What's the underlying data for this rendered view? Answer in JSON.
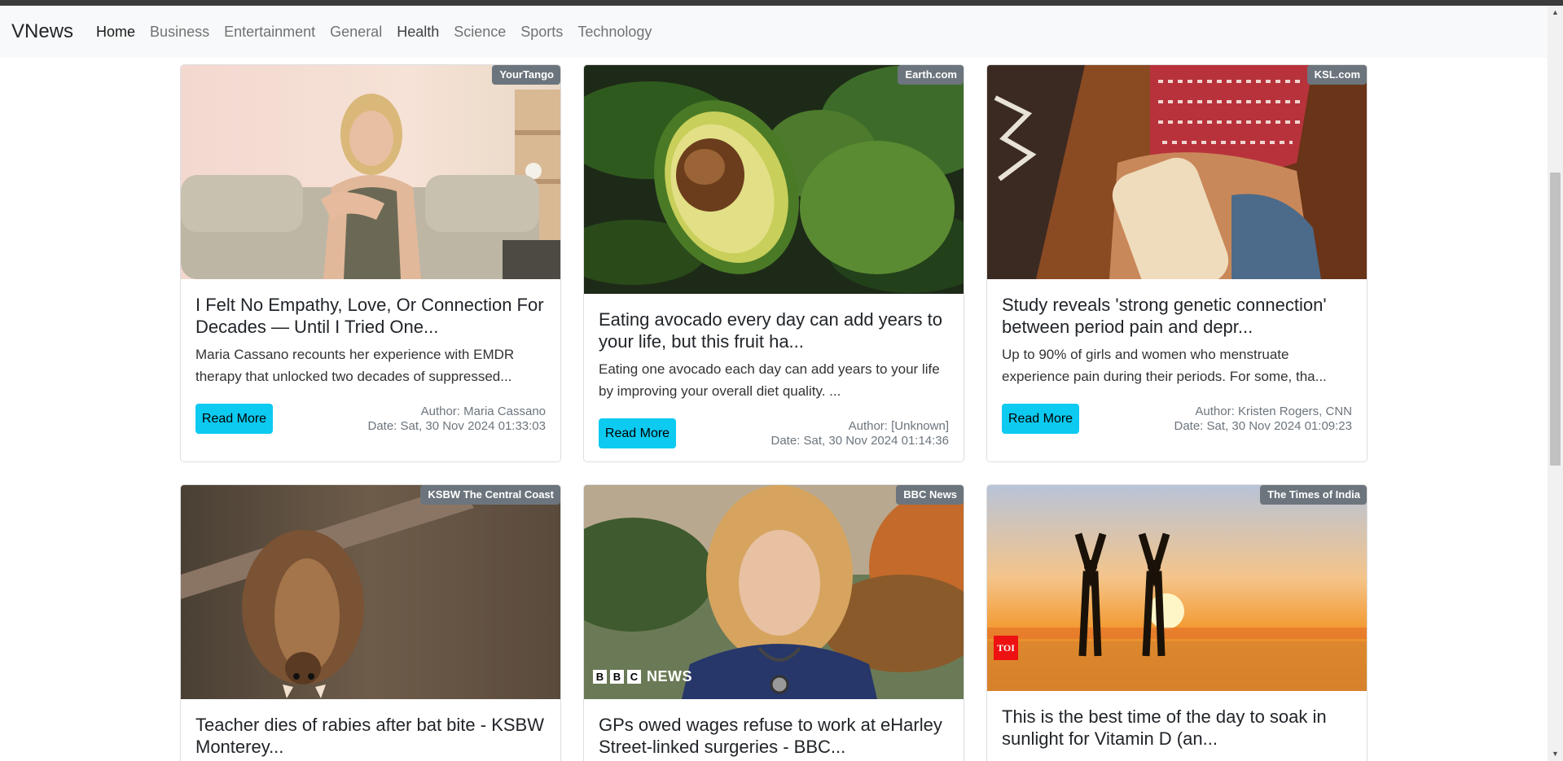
{
  "brand": "VNews",
  "nav": [
    {
      "label": "Home"
    },
    {
      "label": "Business"
    },
    {
      "label": "Entertainment"
    },
    {
      "label": "General"
    },
    {
      "label": "Health"
    },
    {
      "label": "Science"
    },
    {
      "label": "Sports"
    },
    {
      "label": "Technology"
    }
  ],
  "read_more_label": "Read More",
  "articles": [
    {
      "source": "YourTango",
      "title": "I Felt No Empathy, Love, Or Connection For Decades — Until I Tried One...",
      "description": "Maria Cassano recounts her experience with EMDR therapy that unlocked two decades of suppressed...",
      "author": "Author: Maria Cassano",
      "date": "Date: Sat, 30 Nov 2024 01:33:03"
    },
    {
      "source": "Earth.com",
      "title": "Eating avocado every day can add years to your life, but this fruit ha...",
      "description": "Eating one avocado each day can add years to your life by improving your overall diet quality. ...",
      "author": "Author: [Unknown]",
      "date": "Date: Sat, 30 Nov 2024 01:14:36"
    },
    {
      "source": "KSL.com",
      "title": "Study reveals 'strong genetic connection' between period pain and depr...",
      "description": "Up to 90% of girls and women who menstruate experience pain during their periods. For some, tha...",
      "author": "Author: Kristen Rogers, CNN",
      "date": "Date: Sat, 30 Nov 2024 01:09:23"
    },
    {
      "source": "KSBW The Central Coast",
      "title": "Teacher dies of rabies after bat bite - KSBW Monterey..."
    },
    {
      "source": "BBC News",
      "title": "GPs owed wages refuse to work at eHarley Street-linked surgeries - BBC...",
      "logo_text": "NEWS",
      "logo_letters": [
        "B",
        "B",
        "C"
      ]
    },
    {
      "source": "The Times of India",
      "title": "This is the best time of the day to soak in sunlight for Vitamin D (an...",
      "logo_text": "TOI"
    }
  ]
}
